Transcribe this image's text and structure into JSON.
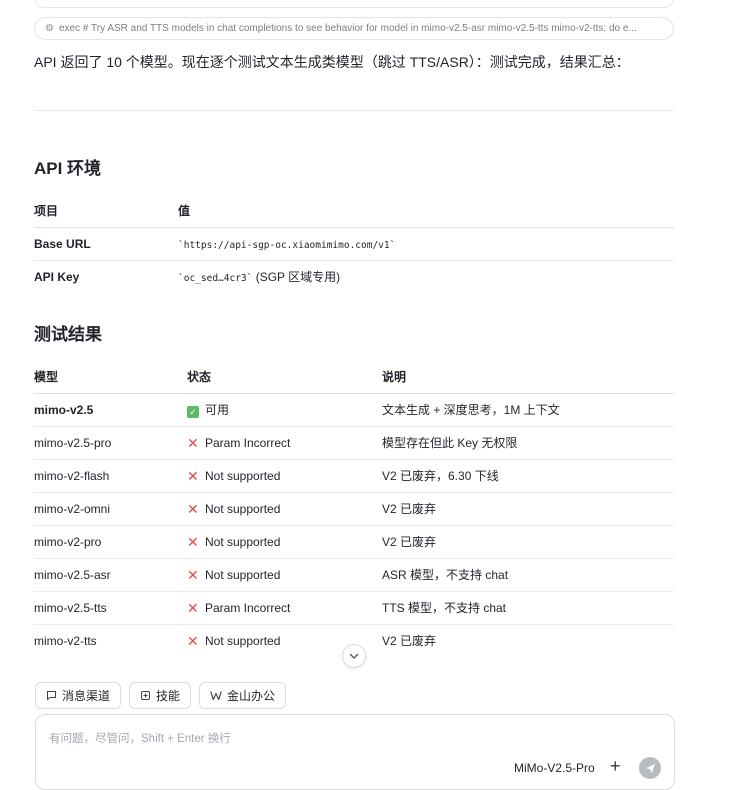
{
  "exec_call": {
    "text": "exec # Try ASR and TTS models in chat completions to see behavior for model in mimo-v2.5-asr mimo-v2.5-tts mimo-v2-tts; do e..."
  },
  "intro_text": "API 返回了 10 个模型。现在逐个测试文本生成类模型（跳过 TTS/ASR）：测试完成，结果汇总：",
  "env_section": {
    "title": "API 环境",
    "headers": [
      "项目",
      "值"
    ],
    "rows": [
      {
        "key": "Base URL",
        "value": "`https://api-sgp-oc.xiaomimimo.com/v1`",
        "note": ""
      },
      {
        "key": "API Key",
        "value": "`oc_sed…4cr3`",
        "note": "(SGP 区域专用)"
      }
    ]
  },
  "results_section": {
    "title": "测试结果",
    "headers": [
      "模型",
      "状态",
      "说明"
    ],
    "rows": [
      {
        "model": "mimo-v2.5",
        "status": "可用",
        "ok": true,
        "note": "文本生成 + 深度思考，1M 上下文"
      },
      {
        "model": "mimo-v2.5-pro",
        "status": "Param Incorrect",
        "ok": false,
        "note": "模型存在但此 Key 无权限"
      },
      {
        "model": "mimo-v2-flash",
        "status": "Not supported",
        "ok": false,
        "note": "V2 已废弃，6.30 下线"
      },
      {
        "model": "mimo-v2-omni",
        "status": "Not supported",
        "ok": false,
        "note": "V2 已废弃"
      },
      {
        "model": "mimo-v2-pro",
        "status": "Not supported",
        "ok": false,
        "note": "V2 已废弃"
      },
      {
        "model": "mimo-v2.5-asr",
        "status": "Not supported",
        "ok": false,
        "note": "ASR 模型，不支持 chat"
      },
      {
        "model": "mimo-v2.5-tts",
        "status": "Param Incorrect",
        "ok": false,
        "note": "TTS 模型，不支持 chat"
      },
      {
        "model": "mimo-v2-tts",
        "status": "Not supported",
        "ok": false,
        "note": "V2 已废弃"
      }
    ]
  },
  "chips": [
    {
      "label": "消息渠道",
      "icon": "message-channel-icon"
    },
    {
      "label": "技能",
      "icon": "skill-icon"
    },
    {
      "label": "金山办公",
      "icon": "wps-office-icon"
    }
  ],
  "composer": {
    "placeholder": "有问题，尽管问，Shift + Enter 换行",
    "model_label": "MiMo-V2.5-Pro"
  },
  "icons": {
    "ok": "check-icon",
    "fail": "cross-icon"
  },
  "colors": {
    "ok": "#5dbb63",
    "fail": "#e5484d",
    "send_button": "#b8bcc2"
  }
}
